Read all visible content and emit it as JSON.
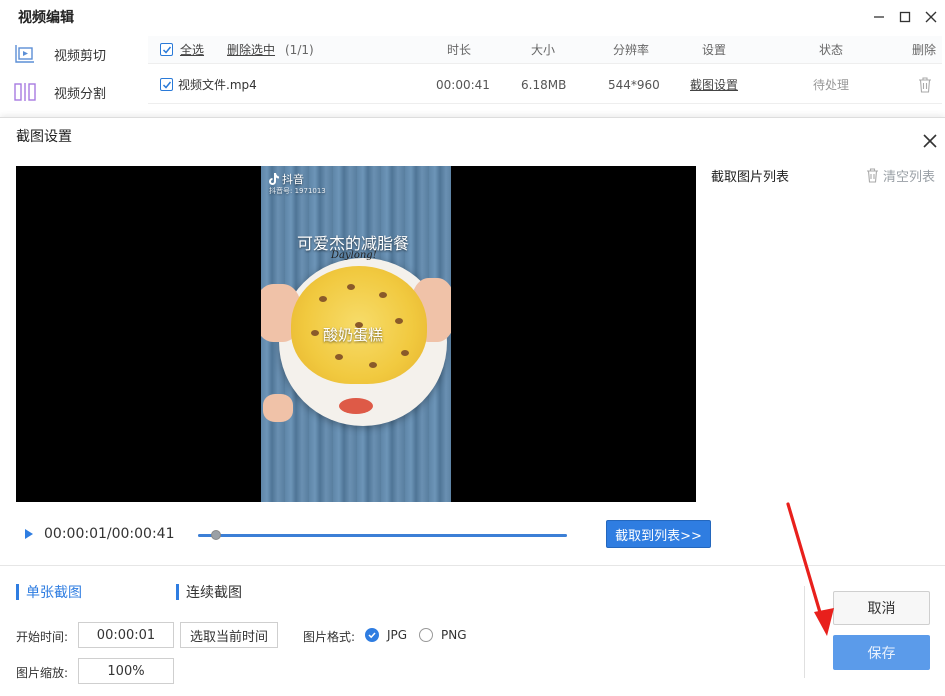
{
  "window": {
    "title": "视频编辑"
  },
  "sidebar": {
    "items": [
      {
        "label": "视频剪切",
        "icon": "video-cut-icon"
      },
      {
        "label": "视频分割",
        "icon": "video-split-icon"
      }
    ]
  },
  "file_list": {
    "select_all": "全选",
    "delete_selected": "删除选中",
    "count": "(1/1)",
    "columns": {
      "duration": "时长",
      "size": "大小",
      "resolution": "分辨率",
      "settings": "设置",
      "status": "状态",
      "delete": "删除"
    },
    "rows": [
      {
        "name": "视频文件.mp4",
        "duration": "00:00:41",
        "size": "6.18MB",
        "resolution": "544*960",
        "settings_link": "截图设置",
        "status": "待处理"
      }
    ]
  },
  "dialog": {
    "title": "截图设置",
    "video_overlay": {
      "logo": "抖音",
      "user_id": "抖音号: 1971013",
      "title_text": "可爱杰的减脂餐",
      "subtitle": "Daylong!",
      "caption": "酸奶蛋糕"
    },
    "player": {
      "time": "00:00:01/00:00:41",
      "progress": 0.05
    },
    "capture_button": "截取到列表>>",
    "image_list": {
      "title": "截取图片列表",
      "clear": "清空列表"
    },
    "tabs": [
      {
        "label": "单张截图",
        "active": true
      },
      {
        "label": "连续截图",
        "active": false
      }
    ],
    "form": {
      "start_time_label": "开始时间:",
      "start_time_value": "00:00:01",
      "select_current": "选取当前时间",
      "format_label": "图片格式:",
      "format_options": [
        "JPG",
        "PNG"
      ],
      "format_selected": "JPG",
      "scale_label": "图片缩放:",
      "scale_value": "100%"
    },
    "buttons": {
      "cancel": "取消",
      "save": "保存"
    }
  },
  "colors": {
    "accent": "#2f7de1",
    "save_button": "#5b9bea",
    "arrow": "#e8201c"
  }
}
